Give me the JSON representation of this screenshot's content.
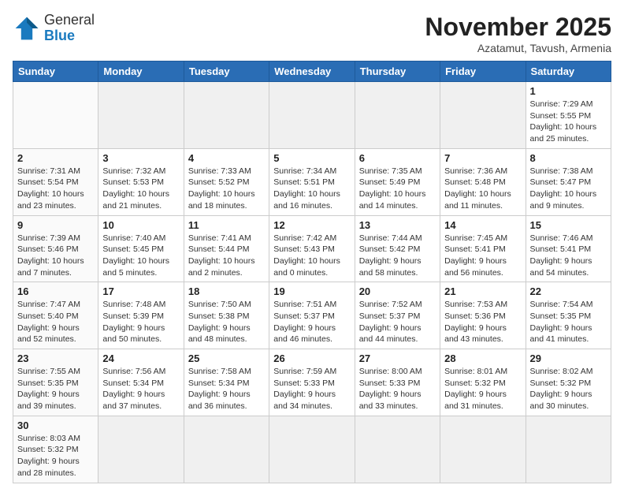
{
  "header": {
    "logo_general": "General",
    "logo_blue": "Blue",
    "month_title": "November 2025",
    "subtitle": "Azatamut, Tavush, Armenia"
  },
  "days_of_week": [
    "Sunday",
    "Monday",
    "Tuesday",
    "Wednesday",
    "Thursday",
    "Friday",
    "Saturday"
  ],
  "weeks": [
    [
      {
        "day": "",
        "info": ""
      },
      {
        "day": "",
        "info": ""
      },
      {
        "day": "",
        "info": ""
      },
      {
        "day": "",
        "info": ""
      },
      {
        "day": "",
        "info": ""
      },
      {
        "day": "",
        "info": ""
      },
      {
        "day": "1",
        "info": "Sunrise: 7:29 AM\nSunset: 5:55 PM\nDaylight: 10 hours and 25 minutes."
      }
    ],
    [
      {
        "day": "2",
        "info": "Sunrise: 7:31 AM\nSunset: 5:54 PM\nDaylight: 10 hours and 23 minutes."
      },
      {
        "day": "3",
        "info": "Sunrise: 7:32 AM\nSunset: 5:53 PM\nDaylight: 10 hours and 21 minutes."
      },
      {
        "day": "4",
        "info": "Sunrise: 7:33 AM\nSunset: 5:52 PM\nDaylight: 10 hours and 18 minutes."
      },
      {
        "day": "5",
        "info": "Sunrise: 7:34 AM\nSunset: 5:51 PM\nDaylight: 10 hours and 16 minutes."
      },
      {
        "day": "6",
        "info": "Sunrise: 7:35 AM\nSunset: 5:49 PM\nDaylight: 10 hours and 14 minutes."
      },
      {
        "day": "7",
        "info": "Sunrise: 7:36 AM\nSunset: 5:48 PM\nDaylight: 10 hours and 11 minutes."
      },
      {
        "day": "8",
        "info": "Sunrise: 7:38 AM\nSunset: 5:47 PM\nDaylight: 10 hours and 9 minutes."
      }
    ],
    [
      {
        "day": "9",
        "info": "Sunrise: 7:39 AM\nSunset: 5:46 PM\nDaylight: 10 hours and 7 minutes."
      },
      {
        "day": "10",
        "info": "Sunrise: 7:40 AM\nSunset: 5:45 PM\nDaylight: 10 hours and 5 minutes."
      },
      {
        "day": "11",
        "info": "Sunrise: 7:41 AM\nSunset: 5:44 PM\nDaylight: 10 hours and 2 minutes."
      },
      {
        "day": "12",
        "info": "Sunrise: 7:42 AM\nSunset: 5:43 PM\nDaylight: 10 hours and 0 minutes."
      },
      {
        "day": "13",
        "info": "Sunrise: 7:44 AM\nSunset: 5:42 PM\nDaylight: 9 hours and 58 minutes."
      },
      {
        "day": "14",
        "info": "Sunrise: 7:45 AM\nSunset: 5:41 PM\nDaylight: 9 hours and 56 minutes."
      },
      {
        "day": "15",
        "info": "Sunrise: 7:46 AM\nSunset: 5:41 PM\nDaylight: 9 hours and 54 minutes."
      }
    ],
    [
      {
        "day": "16",
        "info": "Sunrise: 7:47 AM\nSunset: 5:40 PM\nDaylight: 9 hours and 52 minutes."
      },
      {
        "day": "17",
        "info": "Sunrise: 7:48 AM\nSunset: 5:39 PM\nDaylight: 9 hours and 50 minutes."
      },
      {
        "day": "18",
        "info": "Sunrise: 7:50 AM\nSunset: 5:38 PM\nDaylight: 9 hours and 48 minutes."
      },
      {
        "day": "19",
        "info": "Sunrise: 7:51 AM\nSunset: 5:37 PM\nDaylight: 9 hours and 46 minutes."
      },
      {
        "day": "20",
        "info": "Sunrise: 7:52 AM\nSunset: 5:37 PM\nDaylight: 9 hours and 44 minutes."
      },
      {
        "day": "21",
        "info": "Sunrise: 7:53 AM\nSunset: 5:36 PM\nDaylight: 9 hours and 43 minutes."
      },
      {
        "day": "22",
        "info": "Sunrise: 7:54 AM\nSunset: 5:35 PM\nDaylight: 9 hours and 41 minutes."
      }
    ],
    [
      {
        "day": "23",
        "info": "Sunrise: 7:55 AM\nSunset: 5:35 PM\nDaylight: 9 hours and 39 minutes."
      },
      {
        "day": "24",
        "info": "Sunrise: 7:56 AM\nSunset: 5:34 PM\nDaylight: 9 hours and 37 minutes."
      },
      {
        "day": "25",
        "info": "Sunrise: 7:58 AM\nSunset: 5:34 PM\nDaylight: 9 hours and 36 minutes."
      },
      {
        "day": "26",
        "info": "Sunrise: 7:59 AM\nSunset: 5:33 PM\nDaylight: 9 hours and 34 minutes."
      },
      {
        "day": "27",
        "info": "Sunrise: 8:00 AM\nSunset: 5:33 PM\nDaylight: 9 hours and 33 minutes."
      },
      {
        "day": "28",
        "info": "Sunrise: 8:01 AM\nSunset: 5:32 PM\nDaylight: 9 hours and 31 minutes."
      },
      {
        "day": "29",
        "info": "Sunrise: 8:02 AM\nSunset: 5:32 PM\nDaylight: 9 hours and 30 minutes."
      }
    ],
    [
      {
        "day": "30",
        "info": "Sunrise: 8:03 AM\nSunset: 5:32 PM\nDaylight: 9 hours and 28 minutes."
      },
      {
        "day": "",
        "info": ""
      },
      {
        "day": "",
        "info": ""
      },
      {
        "day": "",
        "info": ""
      },
      {
        "day": "",
        "info": ""
      },
      {
        "day": "",
        "info": ""
      },
      {
        "day": "",
        "info": ""
      }
    ]
  ]
}
